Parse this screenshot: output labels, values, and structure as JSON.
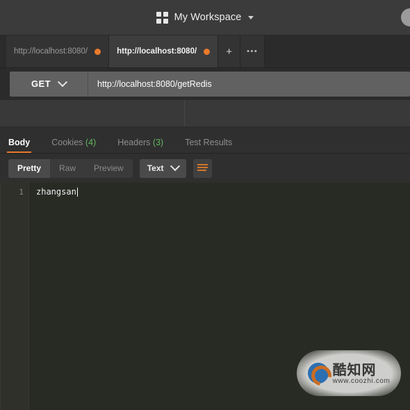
{
  "header": {
    "workspace_icon": "grid-icon",
    "workspace_label": "My Workspace",
    "caret_icon": "chevron-down-icon",
    "avatar": "user-avatar"
  },
  "tabs": {
    "items": [
      {
        "label": "http://localhost:8080/",
        "dirty_dot": "unsaved-dot",
        "active": false
      },
      {
        "label": "http://localhost:8080/",
        "dirty_dot": "unsaved-dot",
        "active": true
      }
    ],
    "new_tab_label": "+",
    "more_label": "•••"
  },
  "request": {
    "method": "GET",
    "method_caret": "chevron-down-icon",
    "url": "http://localhost:8080/getRedis"
  },
  "response": {
    "tabs": [
      {
        "label": "Body",
        "count": "",
        "active": true
      },
      {
        "label": "Cookies",
        "count": "(4)",
        "active": false
      },
      {
        "label": "Headers",
        "count": "(3)",
        "active": false
      },
      {
        "label": "Test Results",
        "count": "",
        "active": false
      }
    ],
    "view_modes": [
      {
        "label": "Pretty",
        "active": true
      },
      {
        "label": "Raw",
        "active": false
      },
      {
        "label": "Preview",
        "active": false
      }
    ],
    "format": "Text",
    "format_caret": "chevron-down-icon",
    "wrap_button": "word-wrap-icon",
    "body_lines": [
      {
        "number": "1",
        "text": "zhangsan"
      }
    ]
  },
  "watermark": {
    "cn_text": "酷知网",
    "url_text": "www.coozhi.com"
  },
  "colors": {
    "accent_orange": "#eb7a2c",
    "count_green": "#63b85f",
    "header_bg": "#3b3b3b",
    "editor_bg": "#282a24"
  }
}
